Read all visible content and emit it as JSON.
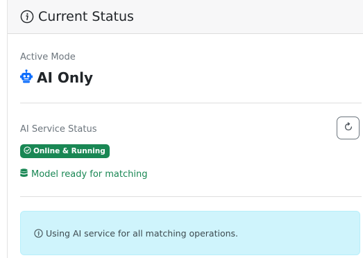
{
  "header": {
    "title": "Current Status",
    "icon": "info-circle-icon"
  },
  "mode": {
    "label": "Active Mode",
    "value": "AI Only",
    "icon": "robot-icon",
    "icon_color": "#0d6efd"
  },
  "service": {
    "label": "AI Service Status",
    "badge": "Online & Running",
    "badge_color": "#198754",
    "model_status": "Model ready for matching",
    "model_icon": "database-icon",
    "refresh_icon": "refresh-icon"
  },
  "alert": {
    "text": "Using AI service for all matching operations.",
    "icon": "info-circle-icon",
    "background": "#cff4fc"
  }
}
